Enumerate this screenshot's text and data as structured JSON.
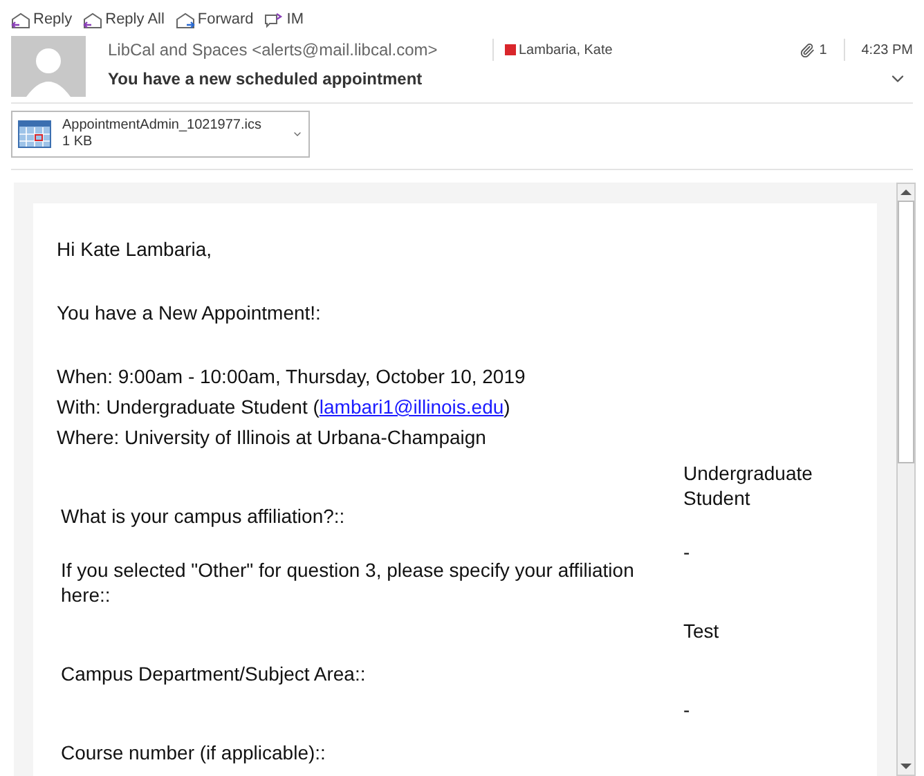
{
  "toolbar": [
    {
      "kind": "reply",
      "label": "Reply"
    },
    {
      "kind": "reply_all",
      "label": "Reply All"
    },
    {
      "kind": "forward",
      "label": "Forward"
    },
    {
      "kind": "im",
      "label": "IM"
    }
  ],
  "message": {
    "sender": "LibCal and Spaces <alerts@mail.libcal.com>",
    "subject": "You have a new scheduled appointment",
    "recipient": {
      "name": "Lambaria, Kate",
      "color": "#d9262b"
    },
    "attachment_count": "1",
    "time": "4:23 PM"
  },
  "attachment": {
    "name": "AppointmentAdmin_1021977.ics",
    "size": "1 KB"
  },
  "body": {
    "greeting": "Hi Kate Lambaria,",
    "intro": "You have a New Appointment!:",
    "when": "When: 9:00am - 10:00am, Thursday, October 10, 2019",
    "with_prefix": "With: Undergraduate Student (",
    "with_link": "lambari1@illinois.edu",
    "with_suffix": ")",
    "where": "Where: University of Illinois at Urbana-Champaign",
    "fields": [
      {
        "question": "What is your campus affiliation?::",
        "answer": "Undergraduate Student"
      },
      {
        "question": "If you selected \"Other\" for question 3, please specify your affiliation here::",
        "answer": "-"
      },
      {
        "question": "Campus Department/Subject Area::",
        "answer": "Test"
      },
      {
        "question": "Course number (if applicable)::",
        "answer": "-"
      }
    ]
  }
}
